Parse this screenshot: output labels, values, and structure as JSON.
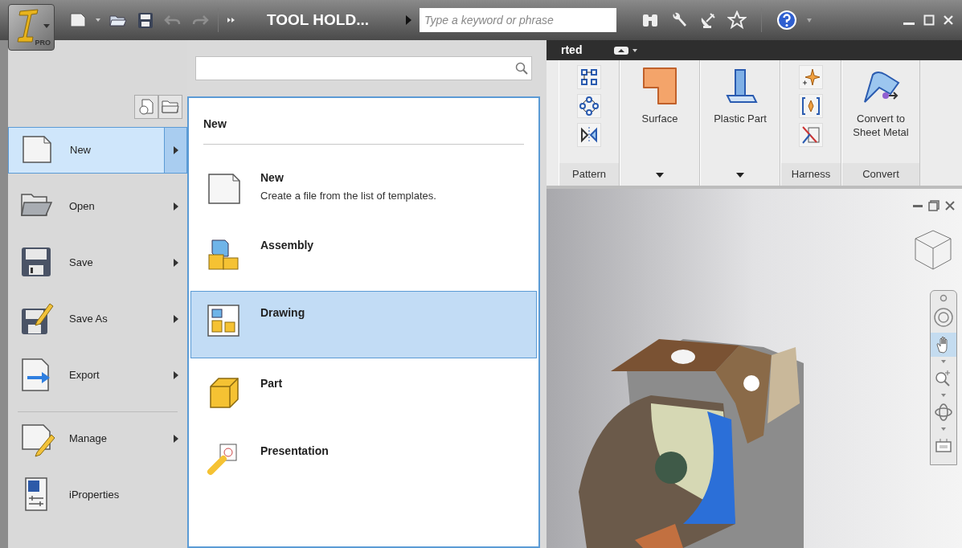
{
  "title_bar": {
    "app_badge": "PRO",
    "document_title": "TOOL HOLD...",
    "search": {
      "placeholder": "Type a keyword or phrase"
    }
  },
  "ribbon": {
    "tab_partial": "rted",
    "panels": [
      {
        "kind": "stack",
        "title": "Pattern"
      },
      {
        "kind": "dropdown",
        "label": "Surface"
      },
      {
        "kind": "dropdown",
        "label": "Plastic Part"
      },
      {
        "kind": "stack",
        "title": "Harness"
      },
      {
        "kind": "large",
        "label": "Convert to Sheet Metal",
        "title": "Convert"
      }
    ]
  },
  "app_menu": {
    "items": [
      {
        "label": "New",
        "selected": true,
        "submenu": true,
        "separator_before": false
      },
      {
        "label": "Open",
        "selected": false,
        "submenu": true,
        "separator_before": false
      },
      {
        "label": "Save",
        "selected": false,
        "submenu": true,
        "separator_before": false
      },
      {
        "label": "Save As",
        "selected": false,
        "submenu": true,
        "separator_before": false
      },
      {
        "label": "Export",
        "selected": false,
        "submenu": true,
        "separator_before": false
      },
      {
        "label": "Manage",
        "selected": false,
        "submenu": true,
        "separator_before": true
      },
      {
        "label": "iProperties",
        "selected": false,
        "submenu": false,
        "separator_before": false
      }
    ],
    "submenu": {
      "heading": "New",
      "items": [
        {
          "title": "New",
          "description": "Create a file from the list of templates.",
          "selected": false
        },
        {
          "title": "Assembly",
          "selected": false
        },
        {
          "title": "Drawing",
          "selected": true
        },
        {
          "title": "Part",
          "selected": false
        },
        {
          "title": "Presentation",
          "selected": false
        }
      ]
    }
  },
  "viewport": {
    "nav_bar": {
      "tools": [
        {
          "kind": "wheel",
          "selected": false
        },
        {
          "kind": "pan",
          "selected": true
        },
        {
          "kind": "zoom",
          "selected": false
        },
        {
          "kind": "orbit",
          "selected": false
        },
        {
          "kind": "look",
          "selected": false
        }
      ]
    }
  }
}
